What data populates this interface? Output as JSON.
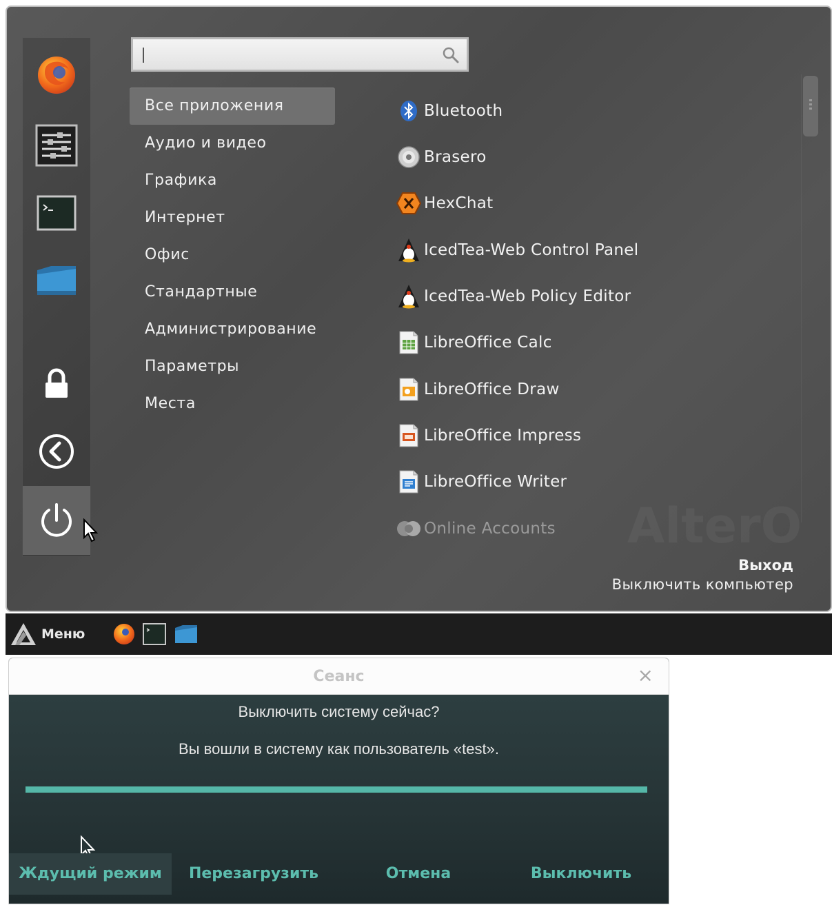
{
  "search": {
    "placeholder": ""
  },
  "categories": [
    "Все приложения",
    "Аудио и видео",
    "Графика",
    "Интернет",
    "Офис",
    "Стандартные",
    "Администрирование",
    "Параметры",
    "Места"
  ],
  "apps": [
    {
      "label": "Bluetooth",
      "icon": "bluetooth-icon"
    },
    {
      "label": "Brasero",
      "icon": "disc-icon"
    },
    {
      "label": "HexChat",
      "icon": "hexchat-icon"
    },
    {
      "label": "IcedTea-Web Control Panel",
      "icon": "java-penguin-icon"
    },
    {
      "label": "IcedTea-Web Policy Editor",
      "icon": "java-penguin-icon"
    },
    {
      "label": "LibreOffice Calc",
      "icon": "calc-document-icon"
    },
    {
      "label": "LibreOffice Draw",
      "icon": "draw-document-icon"
    },
    {
      "label": "LibreOffice Impress",
      "icon": "impress-document-icon"
    },
    {
      "label": "LibreOffice Writer",
      "icon": "writer-document-icon"
    },
    {
      "label": "Online Accounts",
      "icon": "online-accounts-icon"
    }
  ],
  "favorites": [
    "firefox-icon",
    "settings-sliders-icon",
    "terminal-icon",
    "folder-icon"
  ],
  "session_buttons": [
    "lock-icon",
    "logout-icon",
    "power-icon"
  ],
  "description": {
    "title": "Выход",
    "text": "Выключить компьютер"
  },
  "watermark": "AlterO",
  "panel": {
    "menu_label": "Меню",
    "launchers": [
      "firefox-icon",
      "terminal-icon",
      "folder-icon"
    ]
  },
  "dialog": {
    "title": "Сеанс",
    "close": "×",
    "question": "Выключить систему сейчас?",
    "user_info": "Вы вошли в систему как пользователь «test».",
    "progress": 1.0,
    "buttons": {
      "suspend": "Ждущий режим",
      "reboot": "Перезагрузить",
      "cancel": "Отмена",
      "shutdown": "Выключить"
    }
  },
  "colors": {
    "accent": "#5cbdae",
    "menu_bg": "#4f4f4f",
    "panel_bg": "#1d1d1d",
    "dialog_bg": "#273739",
    "progress": "#55b7a8"
  }
}
